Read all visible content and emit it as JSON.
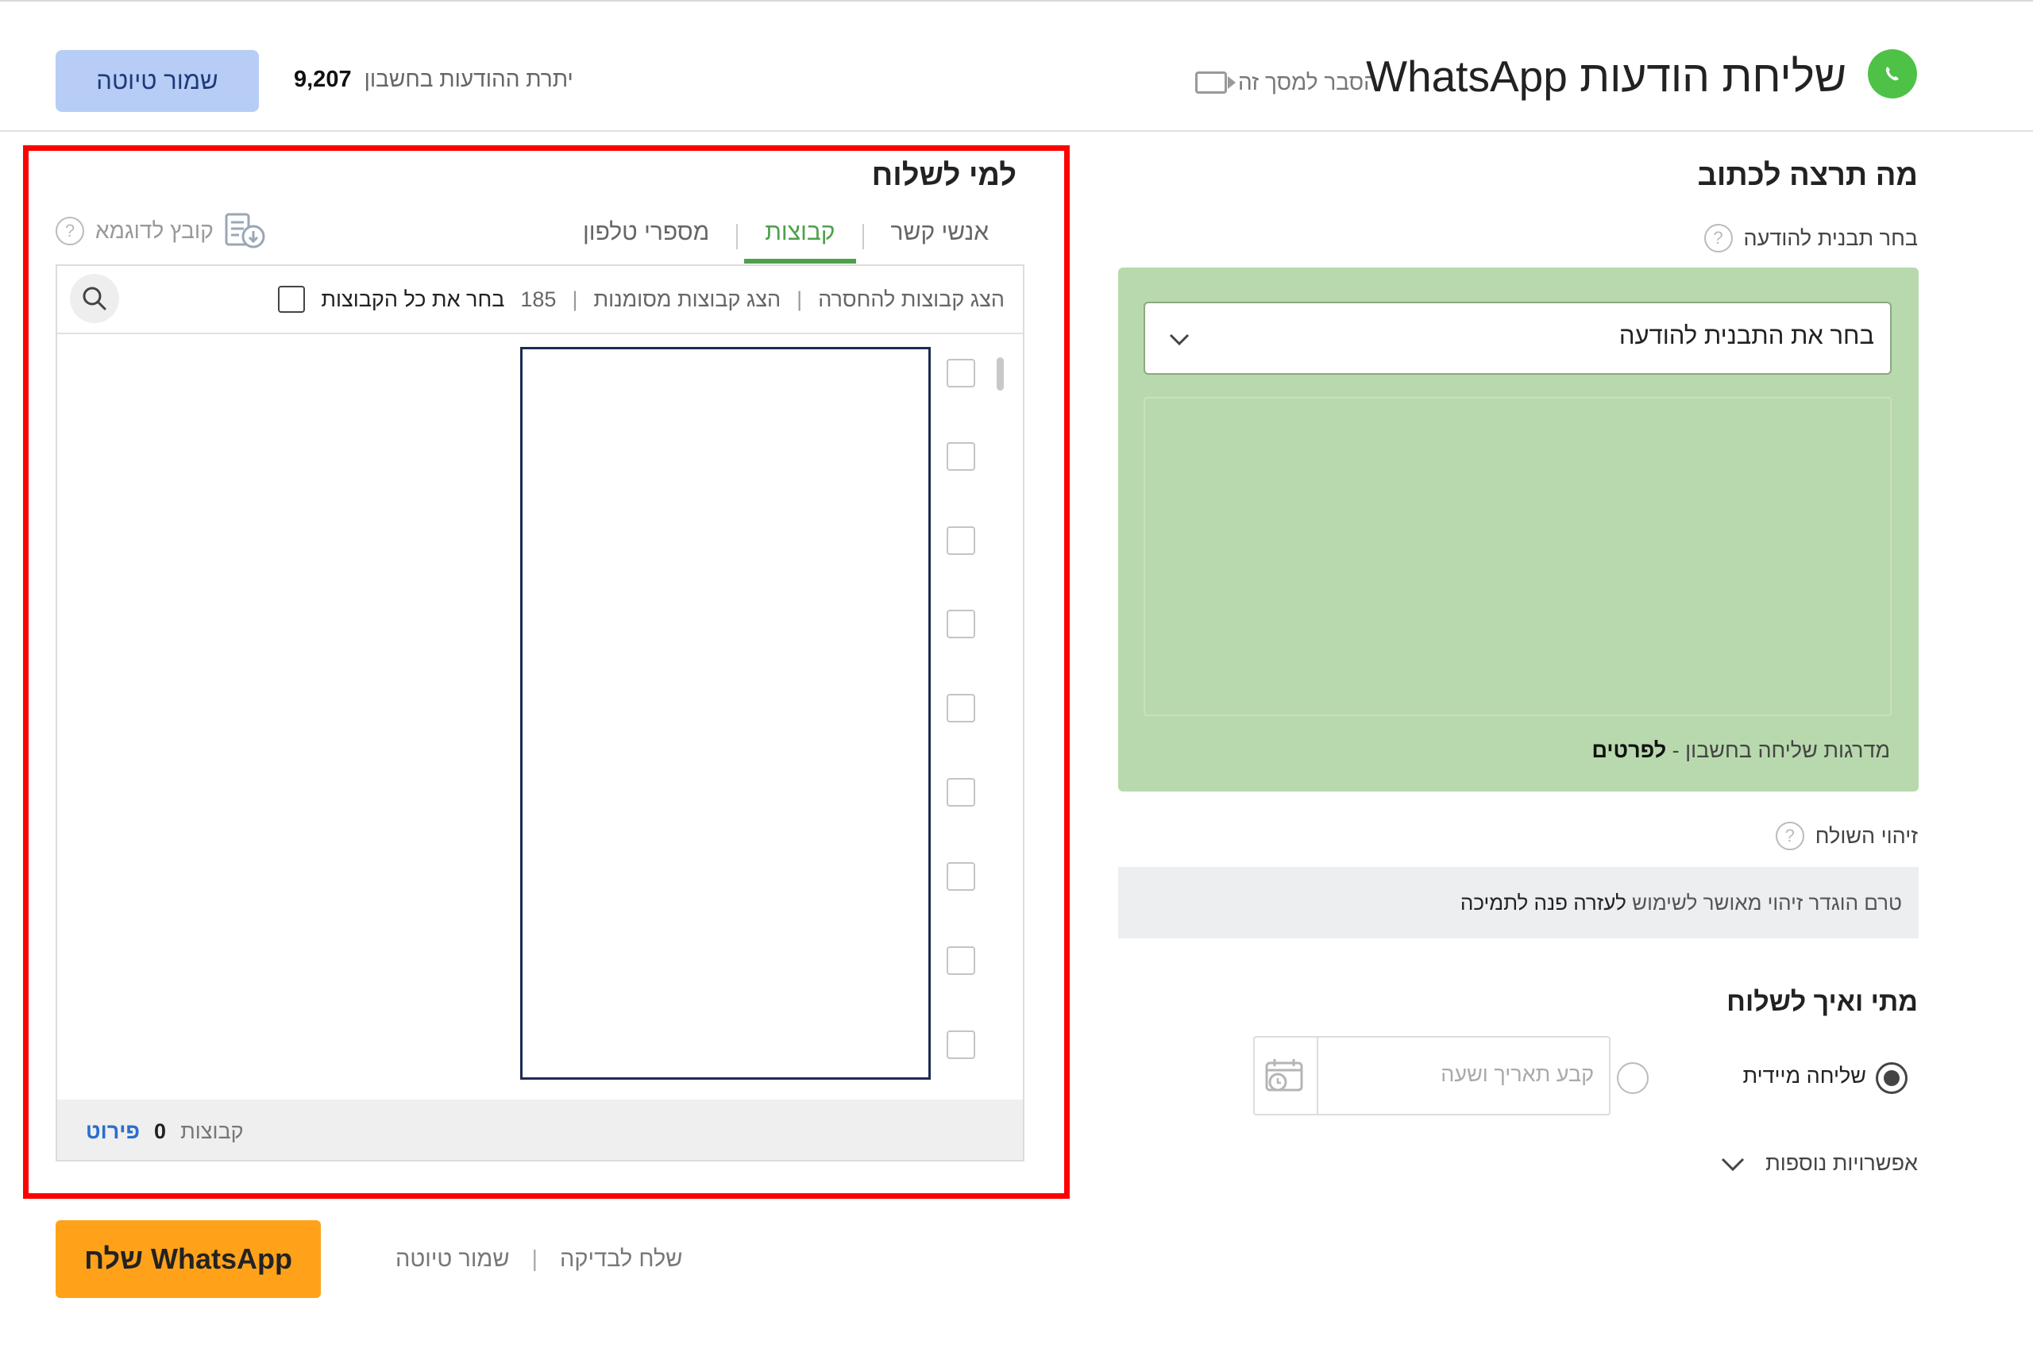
{
  "header": {
    "title": "שליחת הודעות WhatsApp",
    "explain_link": "הסבר למסך זה",
    "balance_label": "יתרת ההודעות בחשבון",
    "balance_value": "9,207",
    "save_draft": "שמור טיוטה"
  },
  "recipients": {
    "title": "למי לשלוח",
    "tabs": [
      {
        "label": "מספרי טלפון",
        "active": false
      },
      {
        "label": "קבוצות",
        "active": true
      },
      {
        "label": "אנשי קשר",
        "active": false
      }
    ],
    "sample_file": "קובץ לדוגמא",
    "help": "?",
    "toolbar": {
      "select_all": "בחר את כל הקבוצות",
      "count": "185",
      "show_marked": "הצג קבוצות מסומנות",
      "show_unsubscribe": "הצג קבוצות להחסרה",
      "separator": "|"
    },
    "footer": {
      "label": "קבוצות",
      "count": "0",
      "details": "פירוט"
    }
  },
  "message": {
    "title": "מה תרצה לכתוב",
    "template_label": "בחר תבנית להודעה",
    "template_select": "בחר את התבנית להודעה",
    "tiers_text": "מדרגות שליחה בחשבון - ",
    "tiers_link": "לפרטים",
    "sender_label": "זיהוי השולח",
    "sender_text": "טרם הוגדר זיהוי מאושר לשימוש ",
    "sender_link": "לעזרה פנה לתמיכה",
    "help": "?"
  },
  "schedule": {
    "title": "מתי ואיך לשלוח",
    "send_now": "שליחה מיידית",
    "date_placeholder": "קבע תאריך ושעה",
    "more_options": "אפשרויות נוספות"
  },
  "actions": {
    "send": "שלח WhatsApp",
    "send_test": "שלח לבדיקה",
    "save_draft": "שמור טיוטה",
    "separator": "|"
  },
  "colors": {
    "accent_green": "#4ea04b",
    "panel_green": "#b8d9ad",
    "send_orange": "#ffa21a",
    "draft_blue": "#b7cdf6",
    "highlight_red": "#ff0000"
  }
}
